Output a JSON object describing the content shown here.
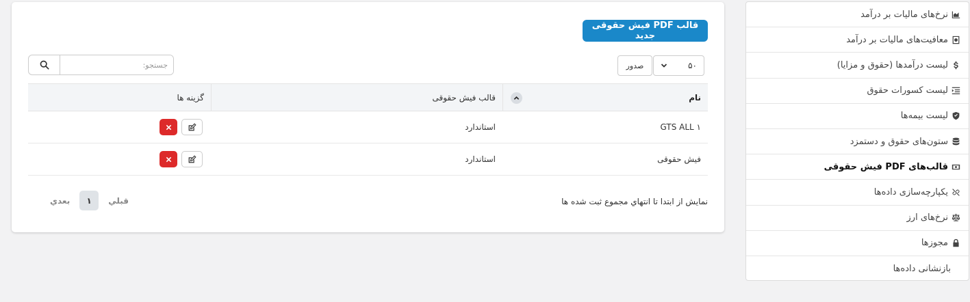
{
  "sidebar": {
    "items": [
      {
        "label": "نرخ‌های مالیات بر درآمد",
        "icon": "chart-area-icon"
      },
      {
        "label": "معافیت‌های مالیات بر درآمد",
        "icon": "receipt-icon"
      },
      {
        "label": "لیست درآمدها (حقوق و مزایا)",
        "icon": "dollar-icon"
      },
      {
        "label": "لیست کسورات حقوق",
        "icon": "indent-list-icon"
      },
      {
        "label": "لیست بیمه‌ها",
        "icon": "shield-icon"
      },
      {
        "label": "ستون‌های حقوق و دستمزد",
        "icon": "database-icon"
      },
      {
        "label": "قالب‌های PDF فیش حقوقی",
        "icon": "money-bill-icon"
      },
      {
        "label": "یکپارچه‌سازی داده‌ها",
        "icon": "link-slash-icon"
      },
      {
        "label": "نرخ‌های ارز",
        "icon": "scale-icon"
      },
      {
        "label": "مجوزها",
        "icon": "lock-icon"
      },
      {
        "label": "بازنشانی داده‌ها",
        "icon": ""
      }
    ],
    "active_index": 6
  },
  "toolbar": {
    "new_button": "قالب PDF فیش حقوقی جدید",
    "page_size": "۵۰",
    "export_label": "صدور",
    "search_placeholder": "جستجو:"
  },
  "table": {
    "headers": {
      "name": "نام",
      "template": "قالب فیش حقوقی",
      "options": "گزینه ها"
    },
    "rows": [
      {
        "name": "GTS ALL ۱",
        "template": "استاندارد"
      },
      {
        "name": "فیش حقوقی",
        "template": "استاندارد"
      }
    ]
  },
  "footer": {
    "info": "نمايش از ابتدا تا انتهاي مجموع ثبت شده ها",
    "prev": "قبلي",
    "page": "۱",
    "next": "بعدي"
  },
  "colors": {
    "primary": "#1a88c9",
    "danger": "#dd2a2a"
  }
}
